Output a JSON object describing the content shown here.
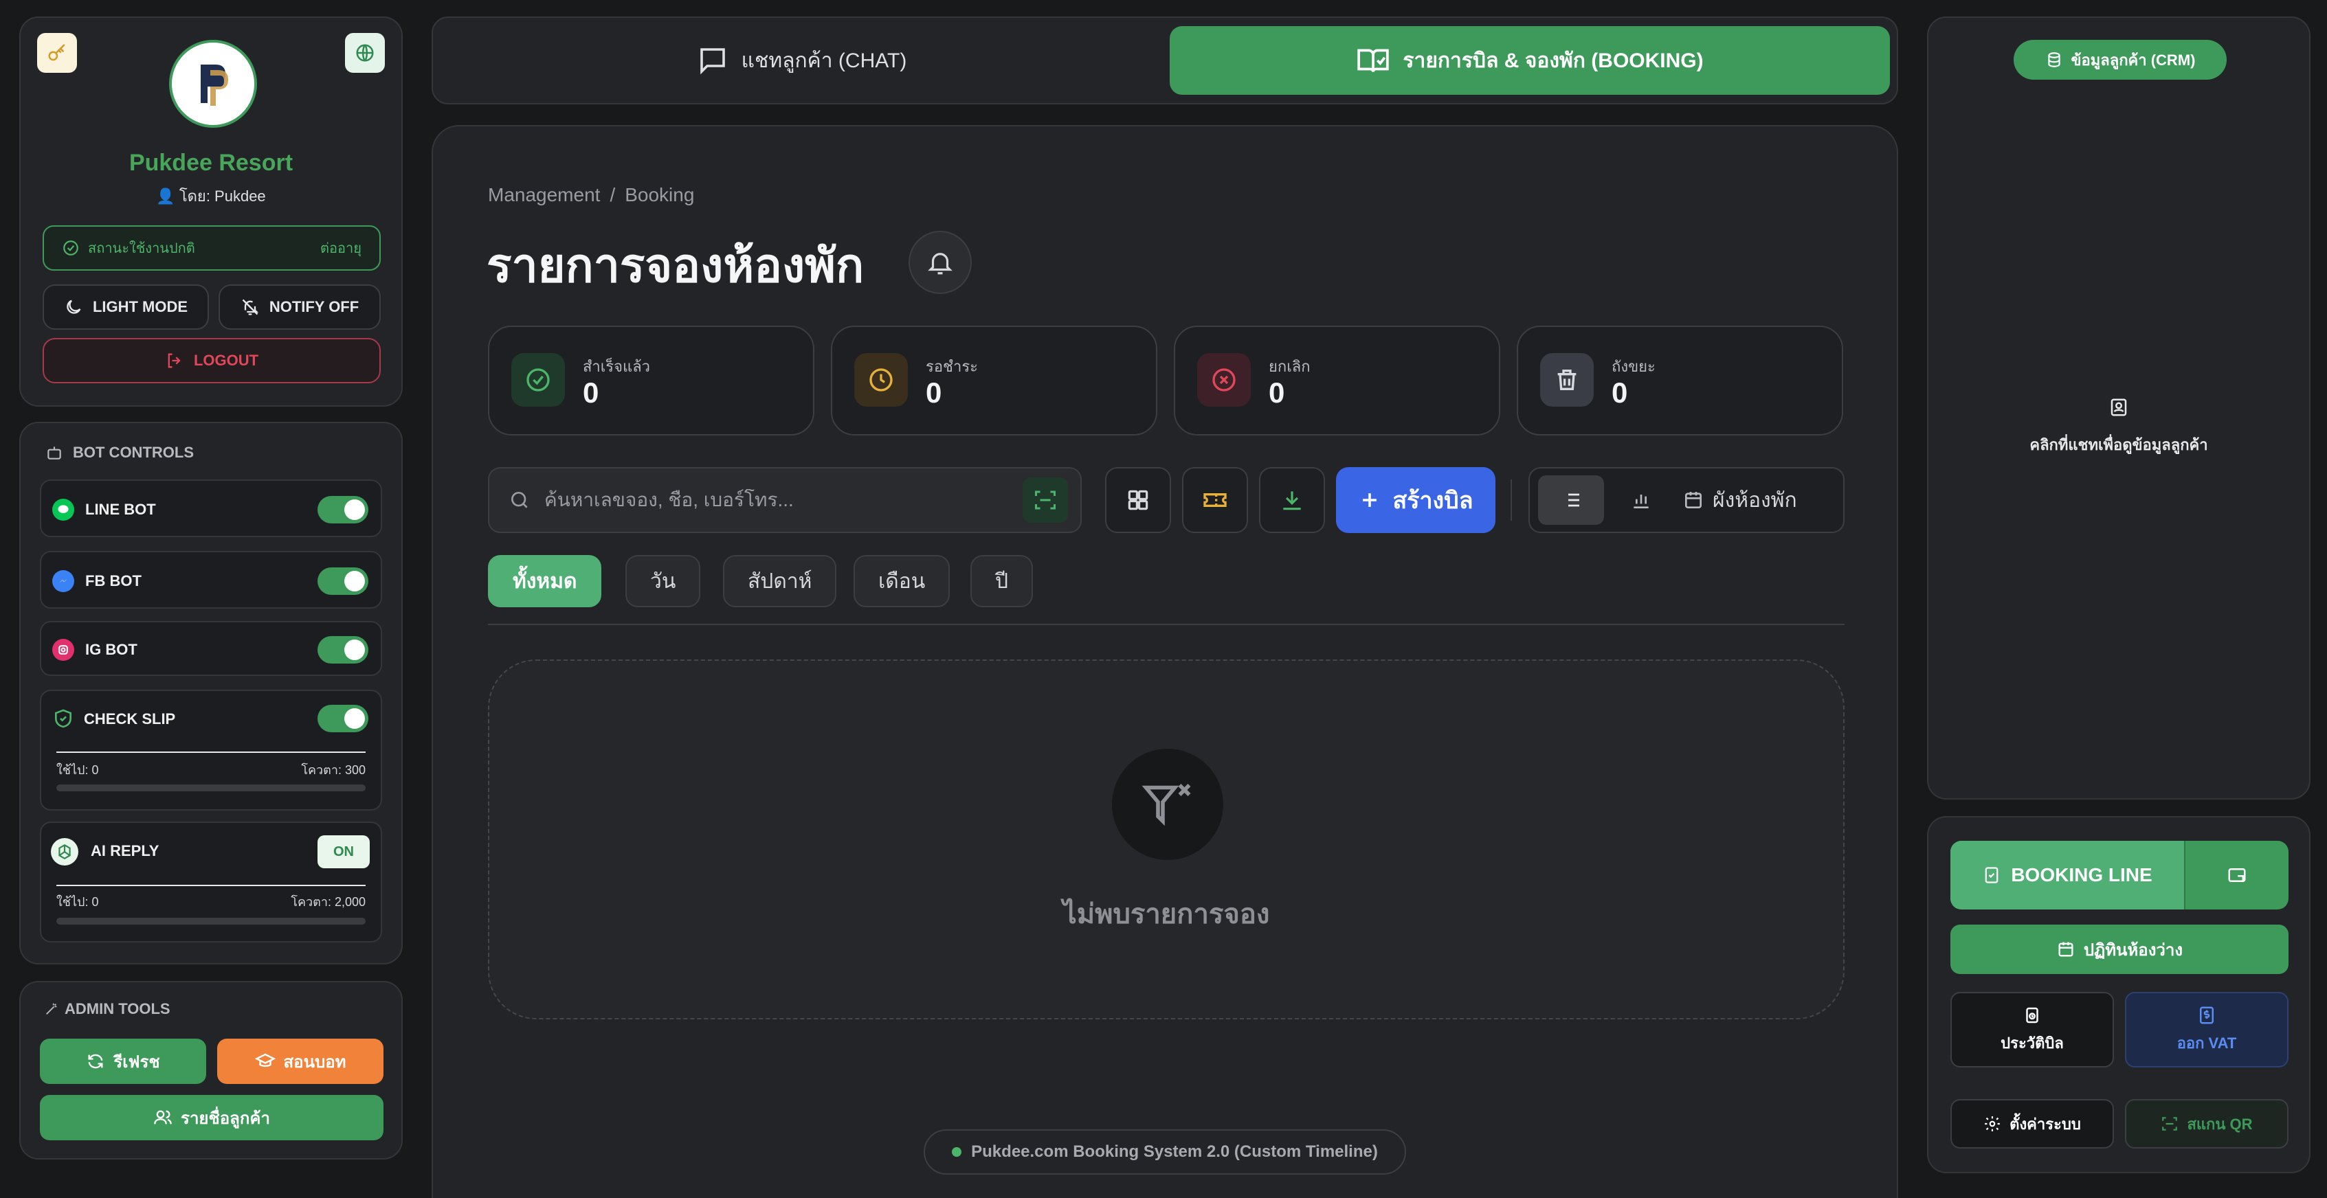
{
  "sidebar": {
    "resort_name": "Pukdee Resort",
    "owner": "👤 โดย: Pukdee",
    "status_text": "สถานะใช้งานปกติ",
    "status_action": "ต่ออายุ",
    "light_mode": "LIGHT MODE",
    "notify_off": "NOTIFY OFF",
    "logout": "LOGOUT"
  },
  "bot_controls": {
    "title": "BOT CONTROLS",
    "line_bot": "LINE BOT",
    "fb_bot": "FB BOT",
    "ig_bot": "IG BOT",
    "check_slip": "CHECK SLIP",
    "check_slip_used": "ใช้ไป: 0",
    "check_slip_quota": "โควตา: 300",
    "ai_reply": "AI REPLY",
    "ai_reply_state": "ON",
    "ai_reply_used": "ใช้ไป: 0",
    "ai_reply_quota": "โควตา: 2,000"
  },
  "admin_tools": {
    "title": "ADMIN TOOLS",
    "refresh": "รีเฟรช",
    "teach_bot": "สอนบอท",
    "customer_list": "รายชื่อลูกค้า"
  },
  "tabs": {
    "chat": "แชทลูกค้า (CHAT)",
    "booking": "รายการบิล & จองพัก (BOOKING)"
  },
  "main": {
    "breadcrumb_root": "Management",
    "breadcrumb_sep": "/",
    "breadcrumb_current": "Booking",
    "title": "รายการจองห้องพัก",
    "stats": [
      {
        "label": "สำเร็จแล้ว",
        "value": "0"
      },
      {
        "label": "รอชำระ",
        "value": "0"
      },
      {
        "label": "ยกเลิก",
        "value": "0"
      },
      {
        "label": "ถังขยะ",
        "value": "0"
      }
    ],
    "search_placeholder": "ค้นหาเลขจอง, ชื่อ, เบอร์โทร...",
    "create_bill": "สร้างบิล",
    "room_chart": "ผังห้องพัก",
    "filters": [
      "ทั้งหมด",
      "วัน",
      "สัปดาห์",
      "เดือน",
      "ปี"
    ],
    "empty_text": "ไม่พบรายการจอง",
    "footer": "Pukdee.com Booking System 2.0 (Custom Timeline)"
  },
  "right": {
    "crm": "ข้อมูลลูกค้า (CRM)",
    "crm_hint": "คลิกที่แชทเพื่อดูข้อมูลลูกค้า",
    "booking_line": "BOOKING LINE",
    "calendar": "ปฏิทินห้องว่าง",
    "bill_history": "ประวัติบิล",
    "vat": "ออก VAT",
    "settings": "ตั้งค่าระบบ",
    "scan_qr": "สแกน QR"
  },
  "colors": {
    "accent_green": "#3d9a5a",
    "brand_green": "#48a65a",
    "blue": "#3a66e6",
    "orange": "#f0823a",
    "danger": "#e0485a",
    "warning": "#e6b23a"
  }
}
